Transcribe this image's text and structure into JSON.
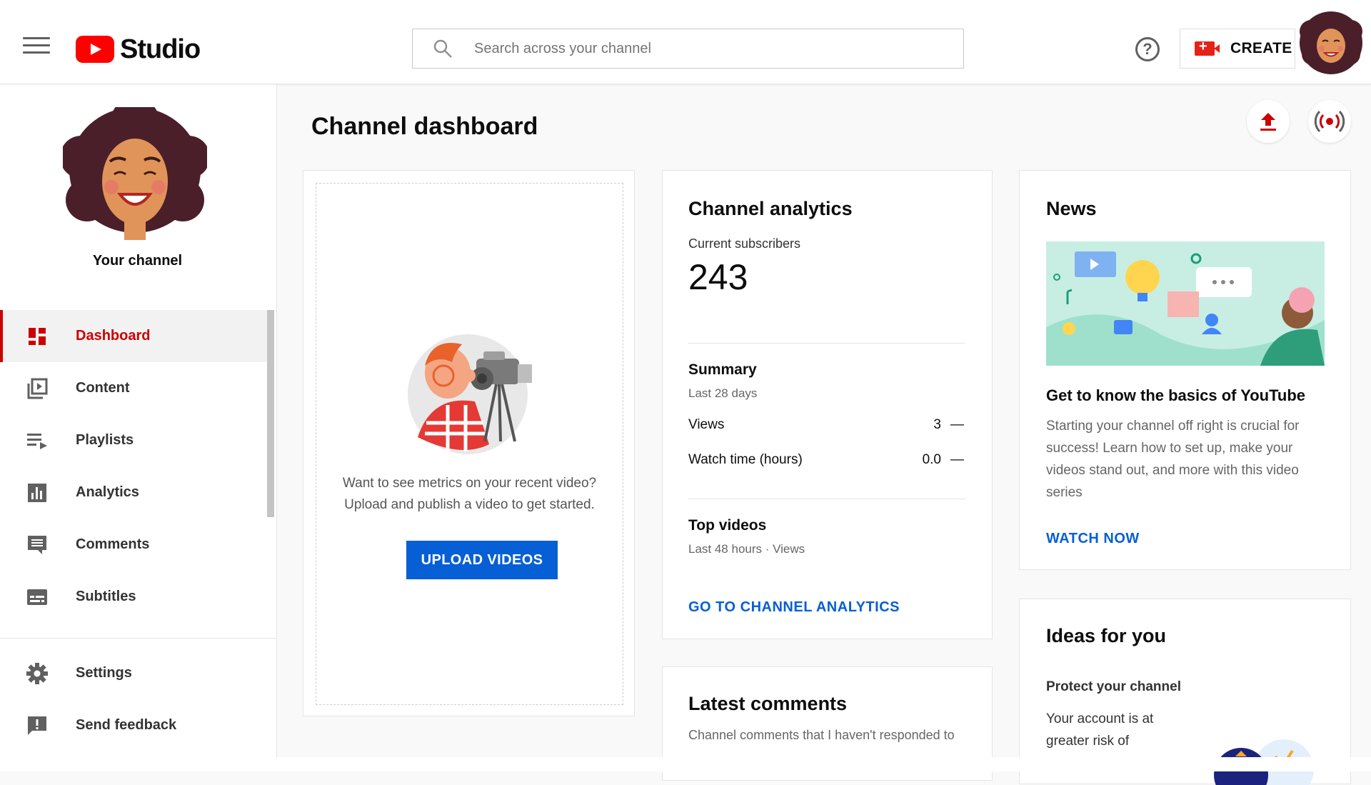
{
  "header": {
    "brand": "Studio",
    "search_placeholder": "Search across your channel",
    "help_symbol": "?",
    "create_label": "CREATE"
  },
  "sidebar": {
    "channel_label": "Your channel",
    "items": [
      {
        "label": "Dashboard",
        "icon": "dashboard-icon",
        "active": true
      },
      {
        "label": "Content",
        "icon": "content-icon"
      },
      {
        "label": "Playlists",
        "icon": "playlists-icon"
      },
      {
        "label": "Analytics",
        "icon": "analytics-icon"
      },
      {
        "label": "Comments",
        "icon": "comments-icon"
      },
      {
        "label": "Subtitles",
        "icon": "subtitles-icon"
      }
    ],
    "bottom_items": [
      {
        "label": "Settings",
        "icon": "settings-icon"
      },
      {
        "label": "Send feedback",
        "icon": "feedback-icon"
      }
    ]
  },
  "main": {
    "title": "Channel dashboard",
    "upload_card": {
      "text_line1": "Want to see metrics on your recent video?",
      "text_line2": "Upload and publish a video to get started.",
      "button": "UPLOAD VIDEOS"
    },
    "analytics": {
      "title": "Channel analytics",
      "subscribers_label": "Current subscribers",
      "subscribers_value": "243",
      "summary_title": "Summary",
      "summary_period": "Last 28 days",
      "rows": [
        {
          "label": "Views",
          "value": "3",
          "delta": "—"
        },
        {
          "label": "Watch time (hours)",
          "value": "0.0",
          "delta": "—"
        }
      ],
      "top_videos_title": "Top videos",
      "top_videos_sub": "Last 48 hours · Views",
      "link": "GO TO CHANNEL ANALYTICS"
    },
    "comments": {
      "title": "Latest comments",
      "desc": "Channel comments that I haven't responded to"
    },
    "news": {
      "title": "News",
      "headline": "Get to know the basics of YouTube",
      "desc": "Starting your channel off right is crucial for success! Learn how to set up, make your videos stand out, and more with this video series",
      "link": "WATCH NOW"
    },
    "ideas": {
      "title": "Ideas for you",
      "subtitle": "Protect your channel",
      "text": "Your account is at greater risk of"
    }
  },
  "colors": {
    "accent_red": "#cc0000",
    "link_blue": "#065fd4",
    "youtube_red": "#ff0000"
  }
}
